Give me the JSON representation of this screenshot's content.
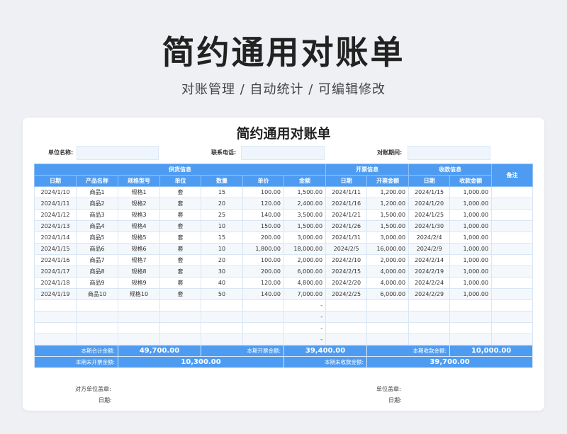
{
  "hero": {
    "title": "简约通用对账单",
    "subtitle": "对账管理 / 自动统计 / 可编辑修改"
  },
  "doc": {
    "title": "简约通用对账单",
    "info": {
      "unit_label": "单位名称:",
      "phone_label": "联系电话:",
      "period_label": "对账期间:"
    },
    "groups": {
      "supply": "供货信息",
      "invoice": "开票信息",
      "receipt": "收款信息",
      "remark": "备注"
    },
    "columns": [
      "日期",
      "产品名称",
      "规格型号",
      "单位",
      "数量",
      "单价",
      "金额",
      "日期",
      "开票金额",
      "日期",
      "收款金额"
    ],
    "rows": [
      [
        "2024/1/10",
        "商品1",
        "规格1",
        "套",
        "15",
        "100.00",
        "1,500.00",
        "2024/1/11",
        "1,200.00",
        "2024/1/15",
        "1,000.00"
      ],
      [
        "2024/1/11",
        "商品2",
        "规格2",
        "套",
        "20",
        "120.00",
        "2,400.00",
        "2024/1/16",
        "1,200.00",
        "2024/1/20",
        "1,000.00"
      ],
      [
        "2024/1/12",
        "商品3",
        "规格3",
        "套",
        "25",
        "140.00",
        "3,500.00",
        "2024/1/21",
        "1,500.00",
        "2024/1/25",
        "1,000.00"
      ],
      [
        "2024/1/13",
        "商品4",
        "规格4",
        "套",
        "10",
        "150.00",
        "1,500.00",
        "2024/1/26",
        "1,500.00",
        "2024/1/30",
        "1,000.00"
      ],
      [
        "2024/1/14",
        "商品5",
        "规格5",
        "套",
        "15",
        "200.00",
        "3,000.00",
        "2024/1/31",
        "3,000.00",
        "2024/2/4",
        "1,000.00"
      ],
      [
        "2024/1/15",
        "商品6",
        "规格6",
        "套",
        "10",
        "1,800.00",
        "18,000.00",
        "2024/2/5",
        "16,000.00",
        "2024/2/9",
        "1,000.00"
      ],
      [
        "2024/1/16",
        "商品7",
        "规格7",
        "套",
        "20",
        "100.00",
        "2,000.00",
        "2024/2/10",
        "2,000.00",
        "2024/2/14",
        "1,000.00"
      ],
      [
        "2024/1/17",
        "商品8",
        "规格8",
        "套",
        "30",
        "200.00",
        "6,000.00",
        "2024/2/15",
        "4,000.00",
        "2024/2/19",
        "1,000.00"
      ],
      [
        "2024/1/18",
        "商品9",
        "规格9",
        "套",
        "40",
        "120.00",
        "4,800.00",
        "2024/2/20",
        "4,000.00",
        "2024/2/24",
        "1,000.00"
      ],
      [
        "2024/1/19",
        "商品10",
        "规格10",
        "套",
        "50",
        "140.00",
        "7,000.00",
        "2024/2/25",
        "6,000.00",
        "2024/2/29",
        "1,000.00"
      ],
      [
        "",
        "",
        "",
        "",
        "",
        "",
        "-",
        "",
        "",
        "",
        ""
      ],
      [
        "",
        "",
        "",
        "",
        "",
        "",
        "-",
        "",
        "",
        "",
        ""
      ],
      [
        "",
        "",
        "",
        "",
        "",
        "",
        "-",
        "",
        "",
        "",
        ""
      ],
      [
        "",
        "",
        "",
        "",
        "",
        "",
        "-",
        "",
        "",
        "",
        ""
      ]
    ],
    "summary": {
      "total_label": "本期合计金额:",
      "total_value": "49,700.00",
      "invoiced_label": "本期开票金额:",
      "invoiced_value": "39,400.00",
      "received_label": "本期收款金额:",
      "received_value": "10,000.00",
      "uninvoiced_label": "本期未开票金额:",
      "uninvoiced_value": "10,300.00",
      "unreceived_label": "本期未收款金额:",
      "unreceived_value": "39,700.00"
    },
    "signature": {
      "party_seal": "对方单位盖章:",
      "party_date": "日期:",
      "own_seal": "单位盖章:",
      "own_date": "日期:"
    }
  }
}
